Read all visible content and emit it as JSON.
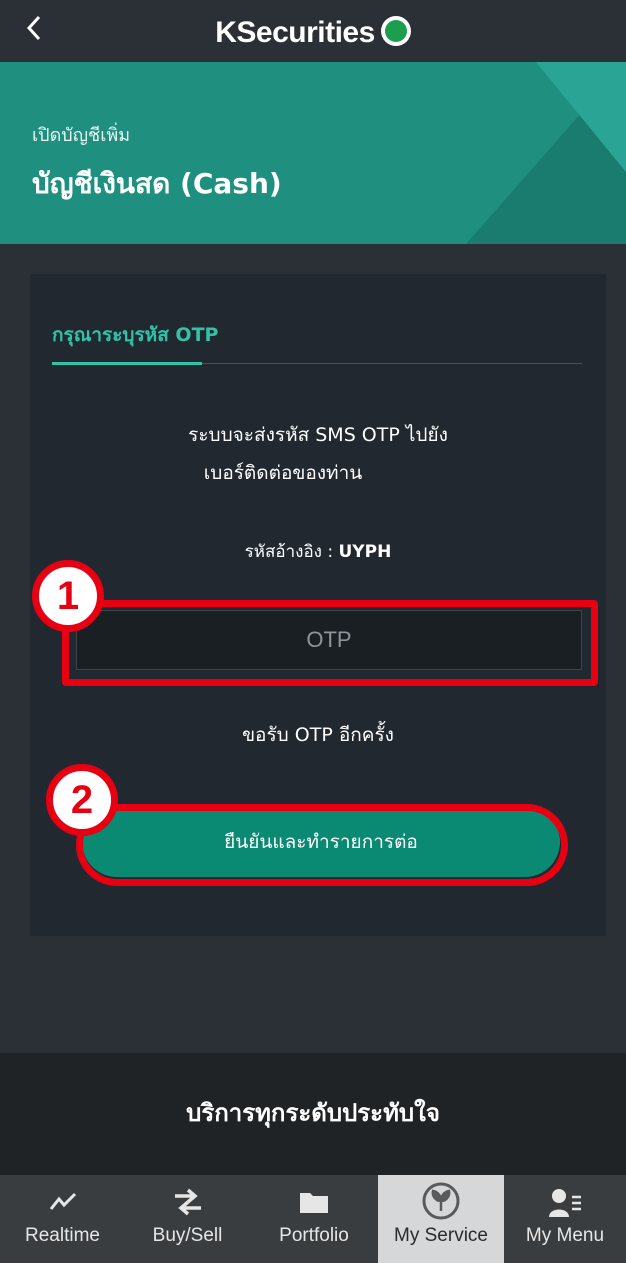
{
  "topbar": {
    "back_icon": "chevron-left-icon",
    "brand": "KSecurities",
    "logo_icon": "kbank-logo-icon"
  },
  "header": {
    "subtitle": "เปิดบัญชีเพิ่ม",
    "title": "บัญชีเงินสด (Cash)"
  },
  "card": {
    "title": "กรุณาระบุรหัส OTP",
    "message_line1": "ระบบจะส่งรหัส SMS OTP ไปยัง",
    "message_line2": "เบอร์ติดต่อของท่าน",
    "ref_label": "รหัสอ้างอิง : ",
    "ref_code": "UYPH",
    "otp_placeholder": "OTP",
    "resend_label": "ขอรับ OTP อีกครั้ง",
    "confirm_label": "ยืนยันและทำรายการต่อ"
  },
  "annotations": {
    "badge1": "1",
    "badge2": "2",
    "highlight_color": "#e60012"
  },
  "slogan": "บริการทุกระดับประทับใจ",
  "tabs": [
    {
      "label": "Realtime",
      "icon": "chart-line-icon"
    },
    {
      "label": "Buy/Sell",
      "icon": "transfer-arrows-icon"
    },
    {
      "label": "Portfolio",
      "icon": "folder-icon"
    },
    {
      "label": "My Service",
      "icon": "kbank-leaf-icon",
      "active": true
    },
    {
      "label": "My Menu",
      "icon": "user-menu-icon"
    }
  ],
  "colors": {
    "accent": "#31c2a7",
    "button": "#0b8a73",
    "header": "#1f8f80",
    "background": "#2b3036"
  }
}
